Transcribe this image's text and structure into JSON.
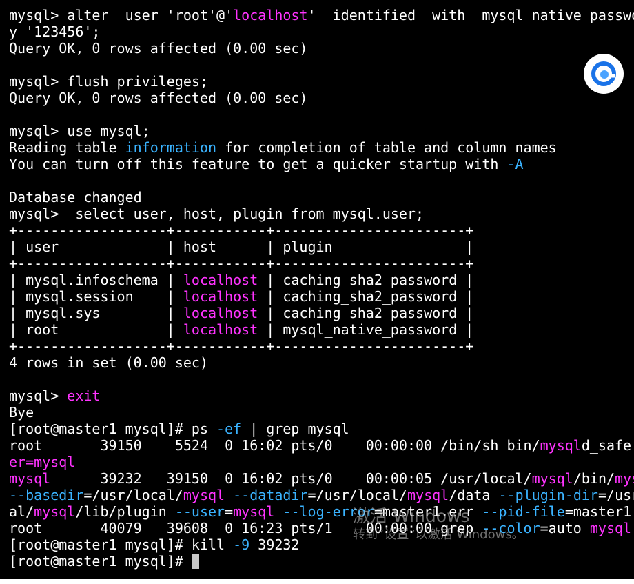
{
  "terminal": {
    "colors": {
      "background": "#000000",
      "text": "#ffffff",
      "cyan": "#3ab3ff",
      "magenta": "#ff33ff"
    },
    "lines": [
      [
        [
          "mysql> alter  user 'root'@'",
          "plain"
        ],
        [
          "localhost",
          "magenta"
        ],
        [
          "'  identified  with  mysql_native_passwo",
          "plain"
        ]
      ],
      [
        [
          "y '123456';",
          "plain"
        ]
      ],
      [
        [
          "Query OK, 0 rows affected (0.00 sec)",
          "plain"
        ]
      ],
      [],
      [
        [
          "mysql> flush privileges;",
          "plain"
        ]
      ],
      [
        [
          "Query OK, 0 rows affected (0.00 sec)",
          "plain"
        ]
      ],
      [],
      [
        [
          "mysql> use mysql;",
          "plain"
        ]
      ],
      [
        [
          "Reading table ",
          "plain"
        ],
        [
          "information",
          "cyan"
        ],
        [
          " for completion of table and column names",
          "plain"
        ]
      ],
      [
        [
          "You can turn off this feature to get a quicker startup with ",
          "plain"
        ],
        [
          "-A",
          "cyan"
        ]
      ],
      [],
      [
        [
          "Database changed",
          "plain"
        ]
      ],
      [
        [
          "mysql>  select user, host, plugin from mysql.user;",
          "plain"
        ]
      ],
      [
        [
          "+------------------+-----------+-----------------------+",
          "plain"
        ]
      ],
      [
        [
          "| user             | host      | plugin                |",
          "plain"
        ]
      ],
      [
        [
          "+------------------+-----------+-----------------------+",
          "plain"
        ]
      ],
      [
        [
          "| mysql.infoschema | ",
          "plain"
        ],
        [
          "localhost",
          "magenta"
        ],
        [
          " | caching_sha2_password |",
          "plain"
        ]
      ],
      [
        [
          "| mysql.session    | ",
          "plain"
        ],
        [
          "localhost",
          "magenta"
        ],
        [
          " | caching_sha2_password |",
          "plain"
        ]
      ],
      [
        [
          "| mysql.sys        | ",
          "plain"
        ],
        [
          "localhost",
          "magenta"
        ],
        [
          " | caching_sha2_password |",
          "plain"
        ]
      ],
      [
        [
          "| root             | ",
          "plain"
        ],
        [
          "localhost",
          "magenta"
        ],
        [
          " | mysql_native_password |",
          "plain"
        ]
      ],
      [
        [
          "+------------------+-----------+-----------------------+",
          "plain"
        ]
      ],
      [
        [
          "4 rows in set (0.00 sec)",
          "plain"
        ]
      ],
      [],
      [
        [
          "mysql> ",
          "plain"
        ],
        [
          "exit",
          "magenta"
        ]
      ],
      [
        [
          "Bye",
          "plain"
        ]
      ],
      [
        [
          "[root@master1 mysql]# ps ",
          "plain"
        ],
        [
          "-ef",
          "cyan"
        ],
        [
          " | grep mysql",
          "plain"
        ]
      ],
      [
        [
          "root       39150    5524  0 16:02 pts/0    00:00:00 /bin/sh bin/",
          "plain"
        ],
        [
          "mysql",
          "magenta"
        ],
        [
          "d_safe",
          "plain"
        ]
      ],
      [
        [
          "er=",
          "magenta"
        ],
        [
          "mysql",
          "magenta"
        ]
      ],
      [
        [
          "mysql",
          "magenta"
        ],
        [
          "      39232   39150  0 16:02 pts/0    00:00:05 /usr/local/",
          "plain"
        ],
        [
          "mysql",
          "magenta"
        ],
        [
          "/bin/",
          "plain"
        ],
        [
          "mys",
          "magenta"
        ]
      ],
      [
        [
          "--basedir",
          "cyan"
        ],
        [
          "=/usr/local/",
          "plain"
        ],
        [
          "mysql",
          "magenta"
        ],
        [
          " ",
          "plain"
        ],
        [
          "--datadir",
          "cyan"
        ],
        [
          "=/usr/local/",
          "plain"
        ],
        [
          "mysql",
          "magenta"
        ],
        [
          "/data ",
          "plain"
        ],
        [
          "--plugin-dir",
          "cyan"
        ],
        [
          "=/usr",
          "plain"
        ]
      ],
      [
        [
          "al/",
          "plain"
        ],
        [
          "mysql",
          "magenta"
        ],
        [
          "/lib/plugin ",
          "plain"
        ],
        [
          "--user",
          "cyan"
        ],
        [
          "=",
          "plain"
        ],
        [
          "mysql",
          "magenta"
        ],
        [
          " ",
          "plain"
        ],
        [
          "--log-error",
          "cyan"
        ],
        [
          "=master1.err ",
          "plain"
        ],
        [
          "--pid-file",
          "cyan"
        ],
        [
          "=master1.",
          "plain"
        ]
      ],
      [
        [
          "root       40079   39608  0 16:23 pts/1    00:00:00 grep ",
          "plain"
        ],
        [
          "--color",
          "cyan"
        ],
        [
          "=auto ",
          "plain"
        ],
        [
          "mysql",
          "magenta"
        ]
      ],
      [
        [
          "[root@master1 mysql]# kill ",
          "plain"
        ],
        [
          "-9",
          "cyan"
        ],
        [
          " 39232",
          "plain"
        ]
      ],
      [
        [
          "[root@master1 mysql]# ",
          "plain"
        ]
      ]
    ]
  },
  "fab": {
    "icon": "browser-e-icon",
    "color": "#1a73e8"
  },
  "watermark": {
    "title": "激活 Windows",
    "subtitle": "转到“设置”以激活 Windows。"
  }
}
